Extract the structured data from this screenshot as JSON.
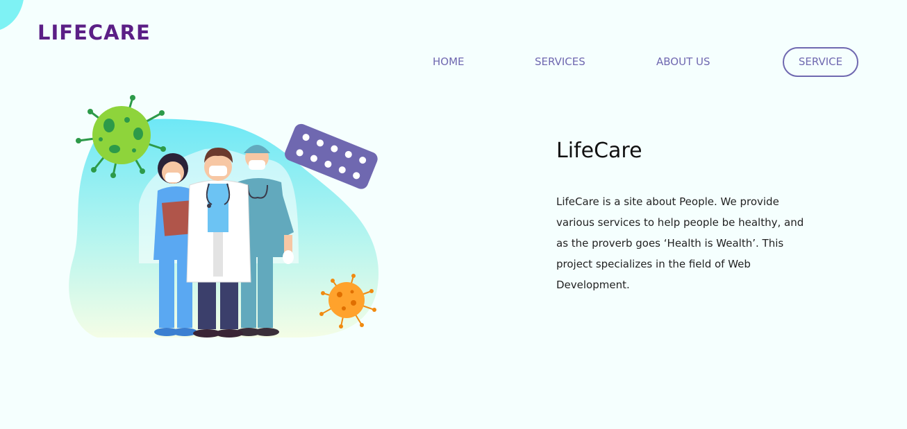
{
  "brand": {
    "logo_text": "LIFECARE",
    "logo_color": "#5b1f86",
    "accent_color": "#6f68b0"
  },
  "nav": {
    "items": [
      {
        "label": "HOME"
      },
      {
        "label": "SERVICES"
      },
      {
        "label": "ABOUT US"
      }
    ],
    "cta_label": "SERVICE"
  },
  "hero": {
    "illustration": "medical-staff-illustration",
    "title": "LifeCare",
    "description": "LifeCare is a site about People. We provide various services to help people be healthy, and as the proverb goes ‘Health is Wealth’. This project specializes in the field of Web Development."
  }
}
